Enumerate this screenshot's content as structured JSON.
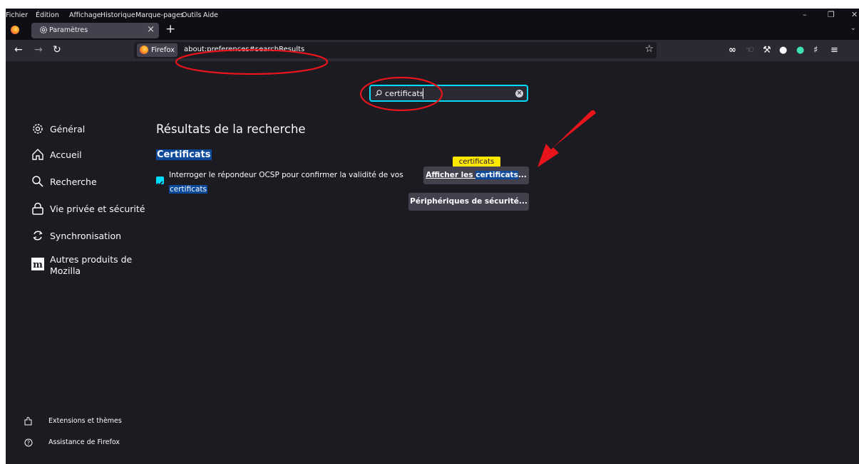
{
  "menubar": {
    "items": [
      "Fichier",
      "Édition",
      "Affichage",
      "Historique",
      "Marque-pages",
      "Outils",
      "Aide"
    ]
  },
  "tab": {
    "title": "Paramètres",
    "close": "×"
  },
  "newtab": "+",
  "urlbar": {
    "identity_label": "Firefox",
    "url": "about:preferences#searchResults"
  },
  "search": {
    "value": "certificats"
  },
  "sidebar": {
    "items": [
      {
        "label": "Général",
        "icon": "gear-icon"
      },
      {
        "label": "Accueil",
        "icon": "home-icon"
      },
      {
        "label": "Recherche",
        "icon": "search-icon"
      },
      {
        "label": "Vie privée et sécurité",
        "icon": "lock-icon"
      },
      {
        "label": "Synchronisation",
        "icon": "sync-icon"
      },
      {
        "label": "Autres produits de",
        "label2": "Mozilla",
        "icon": "mozilla-icon"
      }
    ],
    "footer": [
      {
        "label": "Extensions et thèmes",
        "icon": "puzzle-icon"
      },
      {
        "label": "Assistance de Firefox",
        "icon": "help-icon"
      }
    ]
  },
  "results": {
    "title": "Résultats de la recherche",
    "section": "Certificats",
    "ocsp_line1": "Interroger le répondeur OCSP pour confirmer la validité de vos",
    "ocsp_line2": "certificats",
    "ocsp_checked": true,
    "view_cert_prefix": "Afficher les ",
    "view_cert_hl": "certificats",
    "view_cert_suffix": "...",
    "security_devices": "Périphériques de sécurité...",
    "tooltip": "certificats"
  },
  "colors": {
    "accent": "#00ddff",
    "highlight": "#0b4a9a",
    "annotation": "#e8141b",
    "tooltip": "#ffe900"
  }
}
